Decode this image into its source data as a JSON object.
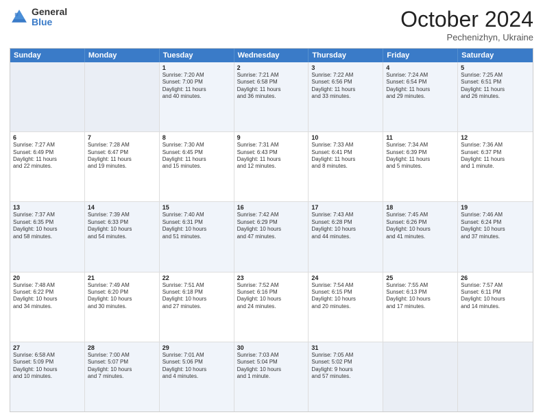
{
  "header": {
    "logo_general": "General",
    "logo_blue": "Blue",
    "month_title": "October 2024",
    "location": "Pechenizhyn, Ukraine"
  },
  "calendar": {
    "days": [
      "Sunday",
      "Monday",
      "Tuesday",
      "Wednesday",
      "Thursday",
      "Friday",
      "Saturday"
    ],
    "rows": [
      [
        {
          "day": "",
          "lines": []
        },
        {
          "day": "",
          "lines": []
        },
        {
          "day": "1",
          "lines": [
            "Sunrise: 7:20 AM",
            "Sunset: 7:00 PM",
            "Daylight: 11 hours",
            "and 40 minutes."
          ]
        },
        {
          "day": "2",
          "lines": [
            "Sunrise: 7:21 AM",
            "Sunset: 6:58 PM",
            "Daylight: 11 hours",
            "and 36 minutes."
          ]
        },
        {
          "day": "3",
          "lines": [
            "Sunrise: 7:22 AM",
            "Sunset: 6:56 PM",
            "Daylight: 11 hours",
            "and 33 minutes."
          ]
        },
        {
          "day": "4",
          "lines": [
            "Sunrise: 7:24 AM",
            "Sunset: 6:54 PM",
            "Daylight: 11 hours",
            "and 29 minutes."
          ]
        },
        {
          "day": "5",
          "lines": [
            "Sunrise: 7:25 AM",
            "Sunset: 6:51 PM",
            "Daylight: 11 hours",
            "and 26 minutes."
          ]
        }
      ],
      [
        {
          "day": "6",
          "lines": [
            "Sunrise: 7:27 AM",
            "Sunset: 6:49 PM",
            "Daylight: 11 hours",
            "and 22 minutes."
          ]
        },
        {
          "day": "7",
          "lines": [
            "Sunrise: 7:28 AM",
            "Sunset: 6:47 PM",
            "Daylight: 11 hours",
            "and 19 minutes."
          ]
        },
        {
          "day": "8",
          "lines": [
            "Sunrise: 7:30 AM",
            "Sunset: 6:45 PM",
            "Daylight: 11 hours",
            "and 15 minutes."
          ]
        },
        {
          "day": "9",
          "lines": [
            "Sunrise: 7:31 AM",
            "Sunset: 6:43 PM",
            "Daylight: 11 hours",
            "and 12 minutes."
          ]
        },
        {
          "day": "10",
          "lines": [
            "Sunrise: 7:33 AM",
            "Sunset: 6:41 PM",
            "Daylight: 11 hours",
            "and 8 minutes."
          ]
        },
        {
          "day": "11",
          "lines": [
            "Sunrise: 7:34 AM",
            "Sunset: 6:39 PM",
            "Daylight: 11 hours",
            "and 5 minutes."
          ]
        },
        {
          "day": "12",
          "lines": [
            "Sunrise: 7:36 AM",
            "Sunset: 6:37 PM",
            "Daylight: 11 hours",
            "and 1 minute."
          ]
        }
      ],
      [
        {
          "day": "13",
          "lines": [
            "Sunrise: 7:37 AM",
            "Sunset: 6:35 PM",
            "Daylight: 10 hours",
            "and 58 minutes."
          ]
        },
        {
          "day": "14",
          "lines": [
            "Sunrise: 7:39 AM",
            "Sunset: 6:33 PM",
            "Daylight: 10 hours",
            "and 54 minutes."
          ]
        },
        {
          "day": "15",
          "lines": [
            "Sunrise: 7:40 AM",
            "Sunset: 6:31 PM",
            "Daylight: 10 hours",
            "and 51 minutes."
          ]
        },
        {
          "day": "16",
          "lines": [
            "Sunrise: 7:42 AM",
            "Sunset: 6:29 PM",
            "Daylight: 10 hours",
            "and 47 minutes."
          ]
        },
        {
          "day": "17",
          "lines": [
            "Sunrise: 7:43 AM",
            "Sunset: 6:28 PM",
            "Daylight: 10 hours",
            "and 44 minutes."
          ]
        },
        {
          "day": "18",
          "lines": [
            "Sunrise: 7:45 AM",
            "Sunset: 6:26 PM",
            "Daylight: 10 hours",
            "and 41 minutes."
          ]
        },
        {
          "day": "19",
          "lines": [
            "Sunrise: 7:46 AM",
            "Sunset: 6:24 PM",
            "Daylight: 10 hours",
            "and 37 minutes."
          ]
        }
      ],
      [
        {
          "day": "20",
          "lines": [
            "Sunrise: 7:48 AM",
            "Sunset: 6:22 PM",
            "Daylight: 10 hours",
            "and 34 minutes."
          ]
        },
        {
          "day": "21",
          "lines": [
            "Sunrise: 7:49 AM",
            "Sunset: 6:20 PM",
            "Daylight: 10 hours",
            "and 30 minutes."
          ]
        },
        {
          "day": "22",
          "lines": [
            "Sunrise: 7:51 AM",
            "Sunset: 6:18 PM",
            "Daylight: 10 hours",
            "and 27 minutes."
          ]
        },
        {
          "day": "23",
          "lines": [
            "Sunrise: 7:52 AM",
            "Sunset: 6:16 PM",
            "Daylight: 10 hours",
            "and 24 minutes."
          ]
        },
        {
          "day": "24",
          "lines": [
            "Sunrise: 7:54 AM",
            "Sunset: 6:15 PM",
            "Daylight: 10 hours",
            "and 20 minutes."
          ]
        },
        {
          "day": "25",
          "lines": [
            "Sunrise: 7:55 AM",
            "Sunset: 6:13 PM",
            "Daylight: 10 hours",
            "and 17 minutes."
          ]
        },
        {
          "day": "26",
          "lines": [
            "Sunrise: 7:57 AM",
            "Sunset: 6:11 PM",
            "Daylight: 10 hours",
            "and 14 minutes."
          ]
        }
      ],
      [
        {
          "day": "27",
          "lines": [
            "Sunrise: 6:58 AM",
            "Sunset: 5:09 PM",
            "Daylight: 10 hours",
            "and 10 minutes."
          ]
        },
        {
          "day": "28",
          "lines": [
            "Sunrise: 7:00 AM",
            "Sunset: 5:07 PM",
            "Daylight: 10 hours",
            "and 7 minutes."
          ]
        },
        {
          "day": "29",
          "lines": [
            "Sunrise: 7:01 AM",
            "Sunset: 5:06 PM",
            "Daylight: 10 hours",
            "and 4 minutes."
          ]
        },
        {
          "day": "30",
          "lines": [
            "Sunrise: 7:03 AM",
            "Sunset: 5:04 PM",
            "Daylight: 10 hours",
            "and 1 minute."
          ]
        },
        {
          "day": "31",
          "lines": [
            "Sunrise: 7:05 AM",
            "Sunset: 5:02 PM",
            "Daylight: 9 hours",
            "and 57 minutes."
          ]
        },
        {
          "day": "",
          "lines": []
        },
        {
          "day": "",
          "lines": []
        }
      ]
    ],
    "alt_rows": [
      0,
      2,
      4
    ]
  }
}
